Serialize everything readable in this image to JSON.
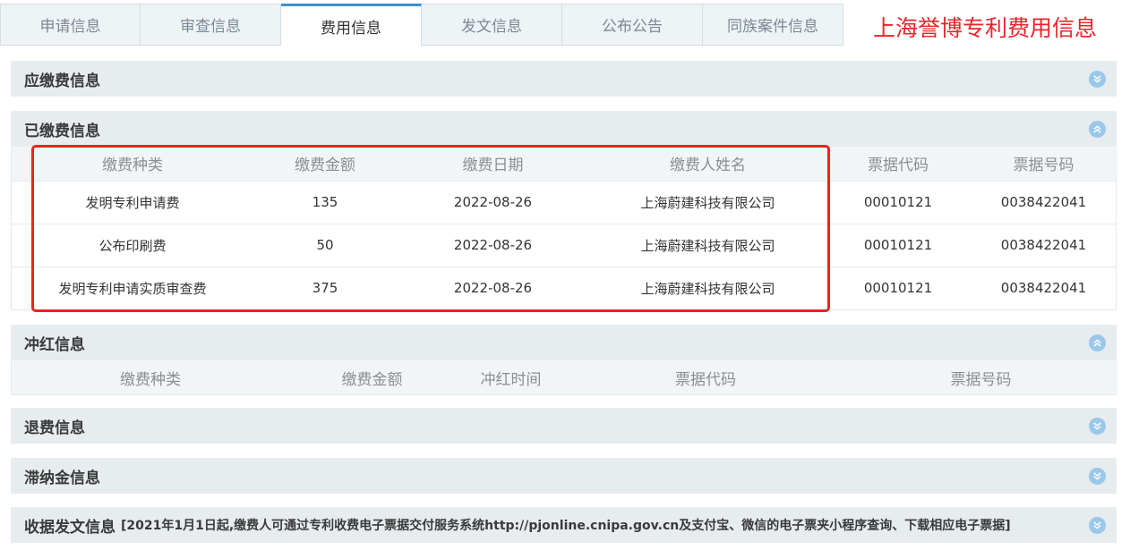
{
  "tabs": [
    {
      "label": "申请信息",
      "active": false
    },
    {
      "label": "审查信息",
      "active": false
    },
    {
      "label": "费用信息",
      "active": true
    },
    {
      "label": "发文信息",
      "active": false
    },
    {
      "label": "公布公告",
      "active": false
    },
    {
      "label": "同族案件信息",
      "active": false
    }
  ],
  "brand_text": "上海誉博专利费用信息",
  "sections": {
    "due": {
      "title": "应缴费信息",
      "expanded": false
    },
    "paid": {
      "title": "已缴费信息",
      "expanded": true,
      "columns": [
        "缴费种类",
        "缴费金额",
        "缴费日期",
        "缴费人姓名",
        "票据代码",
        "票据号码"
      ],
      "rows": [
        [
          "发明专利申请费",
          "135",
          "2022-08-26",
          "上海蔚建科技有限公司",
          "00010121",
          "0038422041"
        ],
        [
          "公布印刷费",
          "50",
          "2022-08-26",
          "上海蔚建科技有限公司",
          "00010121",
          "0038422041"
        ],
        [
          "发明专利申请实质审查费",
          "375",
          "2022-08-26",
          "上海蔚建科技有限公司",
          "00010121",
          "0038422041"
        ]
      ]
    },
    "reversal": {
      "title": "冲红信息",
      "expanded": true,
      "columns": [
        "缴费种类",
        "缴费金额",
        "冲红时间",
        "票据代码",
        "票据号码"
      ]
    },
    "refund": {
      "title": "退费信息",
      "expanded": false
    },
    "late": {
      "title": "滞纳金信息",
      "expanded": false
    },
    "receipt": {
      "title": "收据发文信息",
      "note": "[2021年1月1日起,缴费人可通过专利收费电子票据交付服务系统http://pjonline.cnipa.gov.cn及支付宝、微信的电子票夹小程序查询、下载相应电子票据]",
      "expanded": false
    }
  },
  "colors": {
    "accent": "#3d8fd1",
    "brand": "#e8262b",
    "highlight": "#ee2222",
    "toggle": "#9ac8ea"
  }
}
